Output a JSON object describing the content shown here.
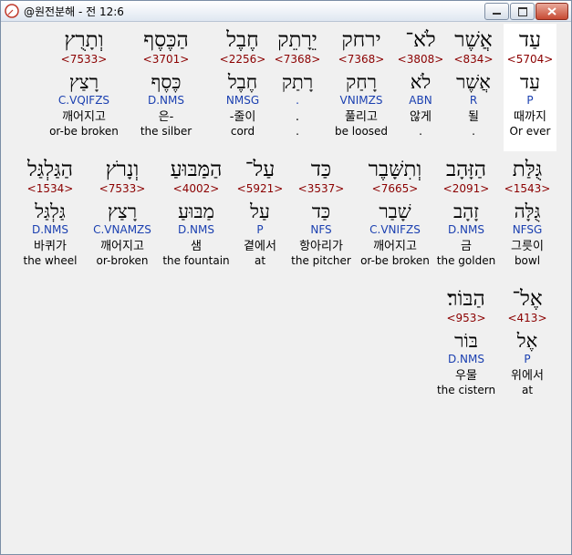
{
  "window": {
    "title": "@원전분해 - 전 12:6",
    "min_label": "",
    "max_label": "",
    "close_label": ""
  },
  "rows": [
    [
      {
        "heb": "עַד",
        "strong": "<5704>",
        "lemma": "עַד",
        "morph": "P",
        "kor": "때까지",
        "eng": "Or ever",
        "highlight": true
      },
      {
        "heb": "אֲשֶׁר",
        "strong": "<834>",
        "lemma": "אֲשֶׁר",
        "morph": "R",
        "kor": "될",
        "eng": "."
      },
      {
        "heb": "לֹא־",
        "strong": "<3808>",
        "lemma": "לֹא",
        "morph": "ABN",
        "kor": "않게",
        "eng": "."
      },
      {
        "heb": "ירחק",
        "strong": "<7368>",
        "lemma": "רָחַק",
        "morph": "VNIMZS",
        "kor": "풀리고",
        "eng": "be loosed"
      },
      {
        "heb": "יֵרָתֵק",
        "strong": "<7368>",
        "lemma": "רָתַק",
        "morph": ".",
        "kor": ".",
        "eng": "."
      },
      {
        "heb": "חֶבֶל",
        "strong": "<2256>",
        "lemma": "חֶבֶל",
        "morph": "NMSG",
        "kor": "-줄이",
        "eng": "cord"
      },
      {
        "heb": "הַכֶּסֶף",
        "strong": "<3701>",
        "lemma": "כֶּסֶף",
        "morph": "D.NMS",
        "kor": "은-",
        "eng": "the silber"
      },
      {
        "heb": "וְתָרֻץ",
        "strong": "<7533>",
        "lemma": "רָצַץ",
        "morph": "C.VQIFZS",
        "kor": "깨어지고",
        "eng": "or-be broken"
      }
    ],
    [
      {
        "heb": "גֻּלַּת",
        "strong": "<1543>",
        "lemma": "גֻּלָּה",
        "morph": "NFSG",
        "kor": "그릇이",
        "eng": "bowl"
      },
      {
        "heb": "הַזָּהָב",
        "strong": "<2091>",
        "lemma": "זָהָב",
        "morph": "D.NMS",
        "kor": "금",
        "eng": "the golden"
      },
      {
        "heb": "וְתִשָּׁבֶר",
        "strong": "<7665>",
        "lemma": "שָׁבַר",
        "morph": "C.VNIFZS",
        "kor": "깨어지고",
        "eng": "or-be broken"
      },
      {
        "heb": "כַּד",
        "strong": "<3537>",
        "lemma": "כַּד",
        "morph": "NFS",
        "kor": "항아리가",
        "eng": "the pitcher"
      },
      {
        "heb": "עַל־",
        "strong": "<5921>",
        "lemma": "עַל",
        "morph": "P",
        "kor": "곁에서",
        "eng": "at"
      },
      {
        "heb": "הַמַּבּוּעַ",
        "strong": "<4002>",
        "lemma": "מַבּוּעַ",
        "morph": "D.NMS",
        "kor": "샘",
        "eng": "the fountain"
      },
      {
        "heb": "וְנָרֹץ",
        "strong": "<7533>",
        "lemma": "רָצַץ",
        "morph": "C.VNAMZS",
        "kor": "깨어지고",
        "eng": "or-broken"
      },
      {
        "heb": "הַגַּלְגַּל",
        "strong": "<1534>",
        "lemma": "גַּלְגַּל",
        "morph": "D.NMS",
        "kor": "바퀴가",
        "eng": "the wheel"
      }
    ],
    [
      {
        "heb": "אֶל־",
        "strong": "<413>",
        "lemma": "אֶל",
        "morph": "P",
        "kor": "위에서",
        "eng": "at"
      },
      {
        "heb": "הַבּוֹר׃",
        "strong": "<953>",
        "lemma": "בּוֹר",
        "morph": "D.NMS",
        "kor": "우물",
        "eng": "the cistern"
      }
    ]
  ]
}
